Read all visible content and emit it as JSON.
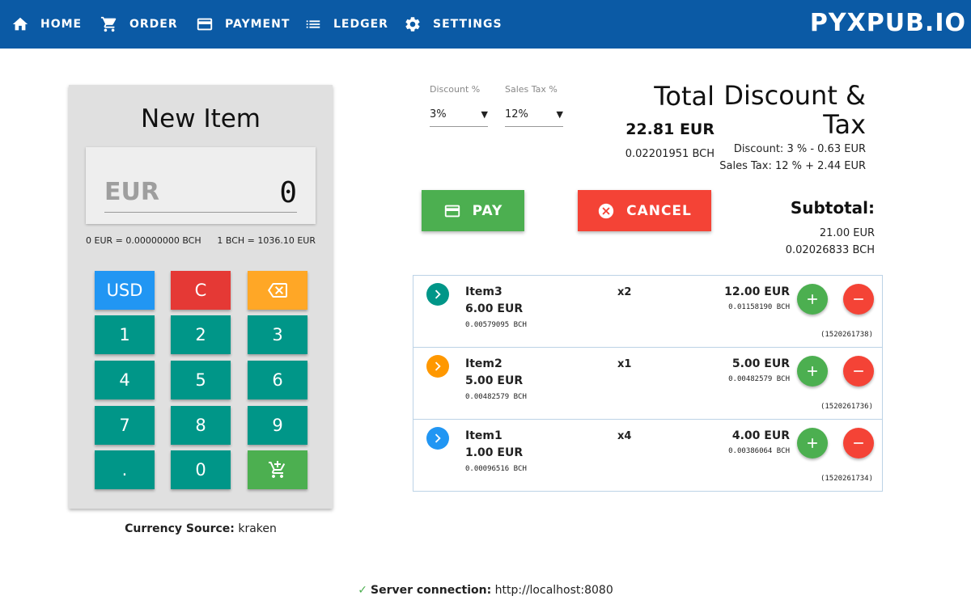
{
  "nav": {
    "items": [
      {
        "label": "HOME",
        "icon": "home-icon"
      },
      {
        "label": "ORDER",
        "icon": "cart-icon"
      },
      {
        "label": "PAYMENT",
        "icon": "credit-card-icon"
      },
      {
        "label": "LEDGER",
        "icon": "list-icon"
      },
      {
        "label": "SETTINGS",
        "icon": "gear-icon"
      }
    ],
    "brand": "PYXPUB.IO",
    "color": "#0b5aa5"
  },
  "keypad": {
    "title": "New Item",
    "display_currency": "EUR",
    "display_value": "0",
    "rate_left": "0 EUR = 0.00000000 BCH",
    "rate_right": "1 BCH = 1036.10 EUR",
    "keys": {
      "usd": "USD",
      "clear": "C",
      "k1": "1",
      "k2": "2",
      "k3": "3",
      "k4": "4",
      "k5": "5",
      "k6": "6",
      "k7": "7",
      "k8": "8",
      "k9": "9",
      "dot": ".",
      "k0": "0"
    },
    "currency_source_label": "Currency Source:",
    "currency_source_value": "kraken"
  },
  "selects": {
    "discount": {
      "label": "Discount %",
      "value": "3%"
    },
    "sales_tax": {
      "label": "Sales Tax %",
      "value": "12%"
    }
  },
  "total": {
    "heading": "Total",
    "eur": "22.81 EUR",
    "bch": "0.02201951 BCH"
  },
  "discount_tax": {
    "heading_line1": "Discount &",
    "heading_line2": "Tax",
    "discount_line": "Discount: 3 % - 0.63 EUR",
    "tax_line": "Sales Tax: 12 % + 2.44 EUR"
  },
  "subtotal": {
    "heading": "Subtotal:",
    "eur": "21.00 EUR",
    "bch": "0.02026833 BCH"
  },
  "buttons": {
    "pay": "PAY",
    "cancel": "CANCEL"
  },
  "items": [
    {
      "name": "Item3",
      "price": "6.00 EUR",
      "price_bch": "0.00579095 BCH",
      "qty": "x2",
      "total": "12.00 EUR",
      "total_bch": "0.01158190 BCH",
      "id": "(1520261738)",
      "chevron_color": "#009688"
    },
    {
      "name": "Item2",
      "price": "5.00 EUR",
      "price_bch": "0.00482579 BCH",
      "qty": "x1",
      "total": "5.00 EUR",
      "total_bch": "0.00482579 BCH",
      "id": "(1520261736)",
      "chevron_color": "#ff9800"
    },
    {
      "name": "Item1",
      "price": "1.00 EUR",
      "price_bch": "0.00096516 BCH",
      "qty": "x4",
      "total": "4.00 EUR",
      "total_bch": "0.00386064 BCH",
      "id": "(1520261734)",
      "chevron_color": "#2196f3"
    }
  ],
  "server": {
    "label": "Server connection:",
    "value": "http://localhost:8080"
  }
}
